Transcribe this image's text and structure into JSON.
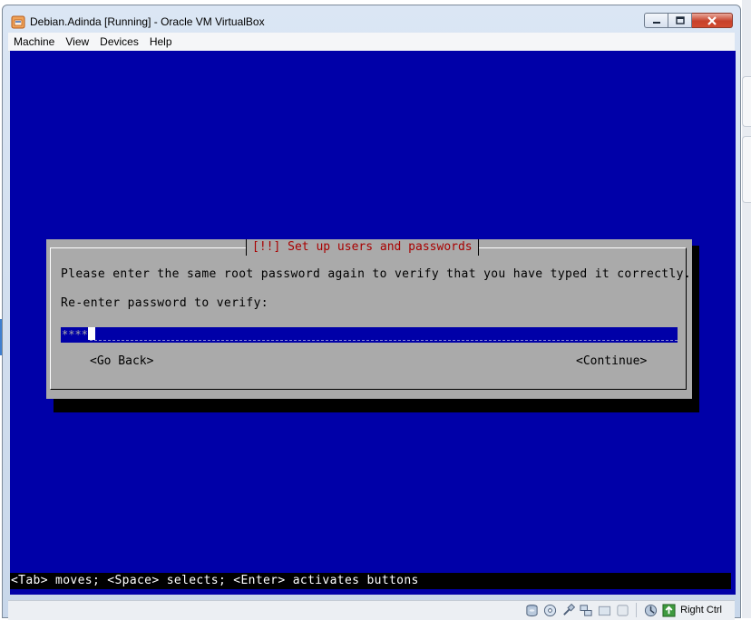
{
  "window": {
    "title": "Debian.Adinda [Running] - Oracle VM VirtualBox"
  },
  "menubar": {
    "items": [
      {
        "label": "Machine"
      },
      {
        "label": "View"
      },
      {
        "label": "Devices"
      },
      {
        "label": "Help"
      }
    ]
  },
  "installer": {
    "dialog_title": "[!!] Set up users and passwords",
    "prompt": "Please enter the same root password again to verify that you have typed it correctly.",
    "field_label": "Re-enter password to verify:",
    "password_mask": "****",
    "go_back_label": "<Go Back>",
    "continue_label": "<Continue>",
    "hint": "<Tab> moves; <Space> selects; <Enter> activates buttons"
  },
  "statusbar": {
    "host_key": "Right Ctrl",
    "icons": [
      "hard-disk-icon",
      "optical-drive-icon",
      "usb-icon",
      "network-icon",
      "shared-folders-icon",
      "display-icon",
      "mouse-integration-icon",
      "host-key-arrow-icon"
    ]
  },
  "colors": {
    "vm_background": "#0000a8",
    "dialog_background": "#aaaaaa",
    "dialog_title": "#a80000",
    "field_background": "#0000a8"
  }
}
